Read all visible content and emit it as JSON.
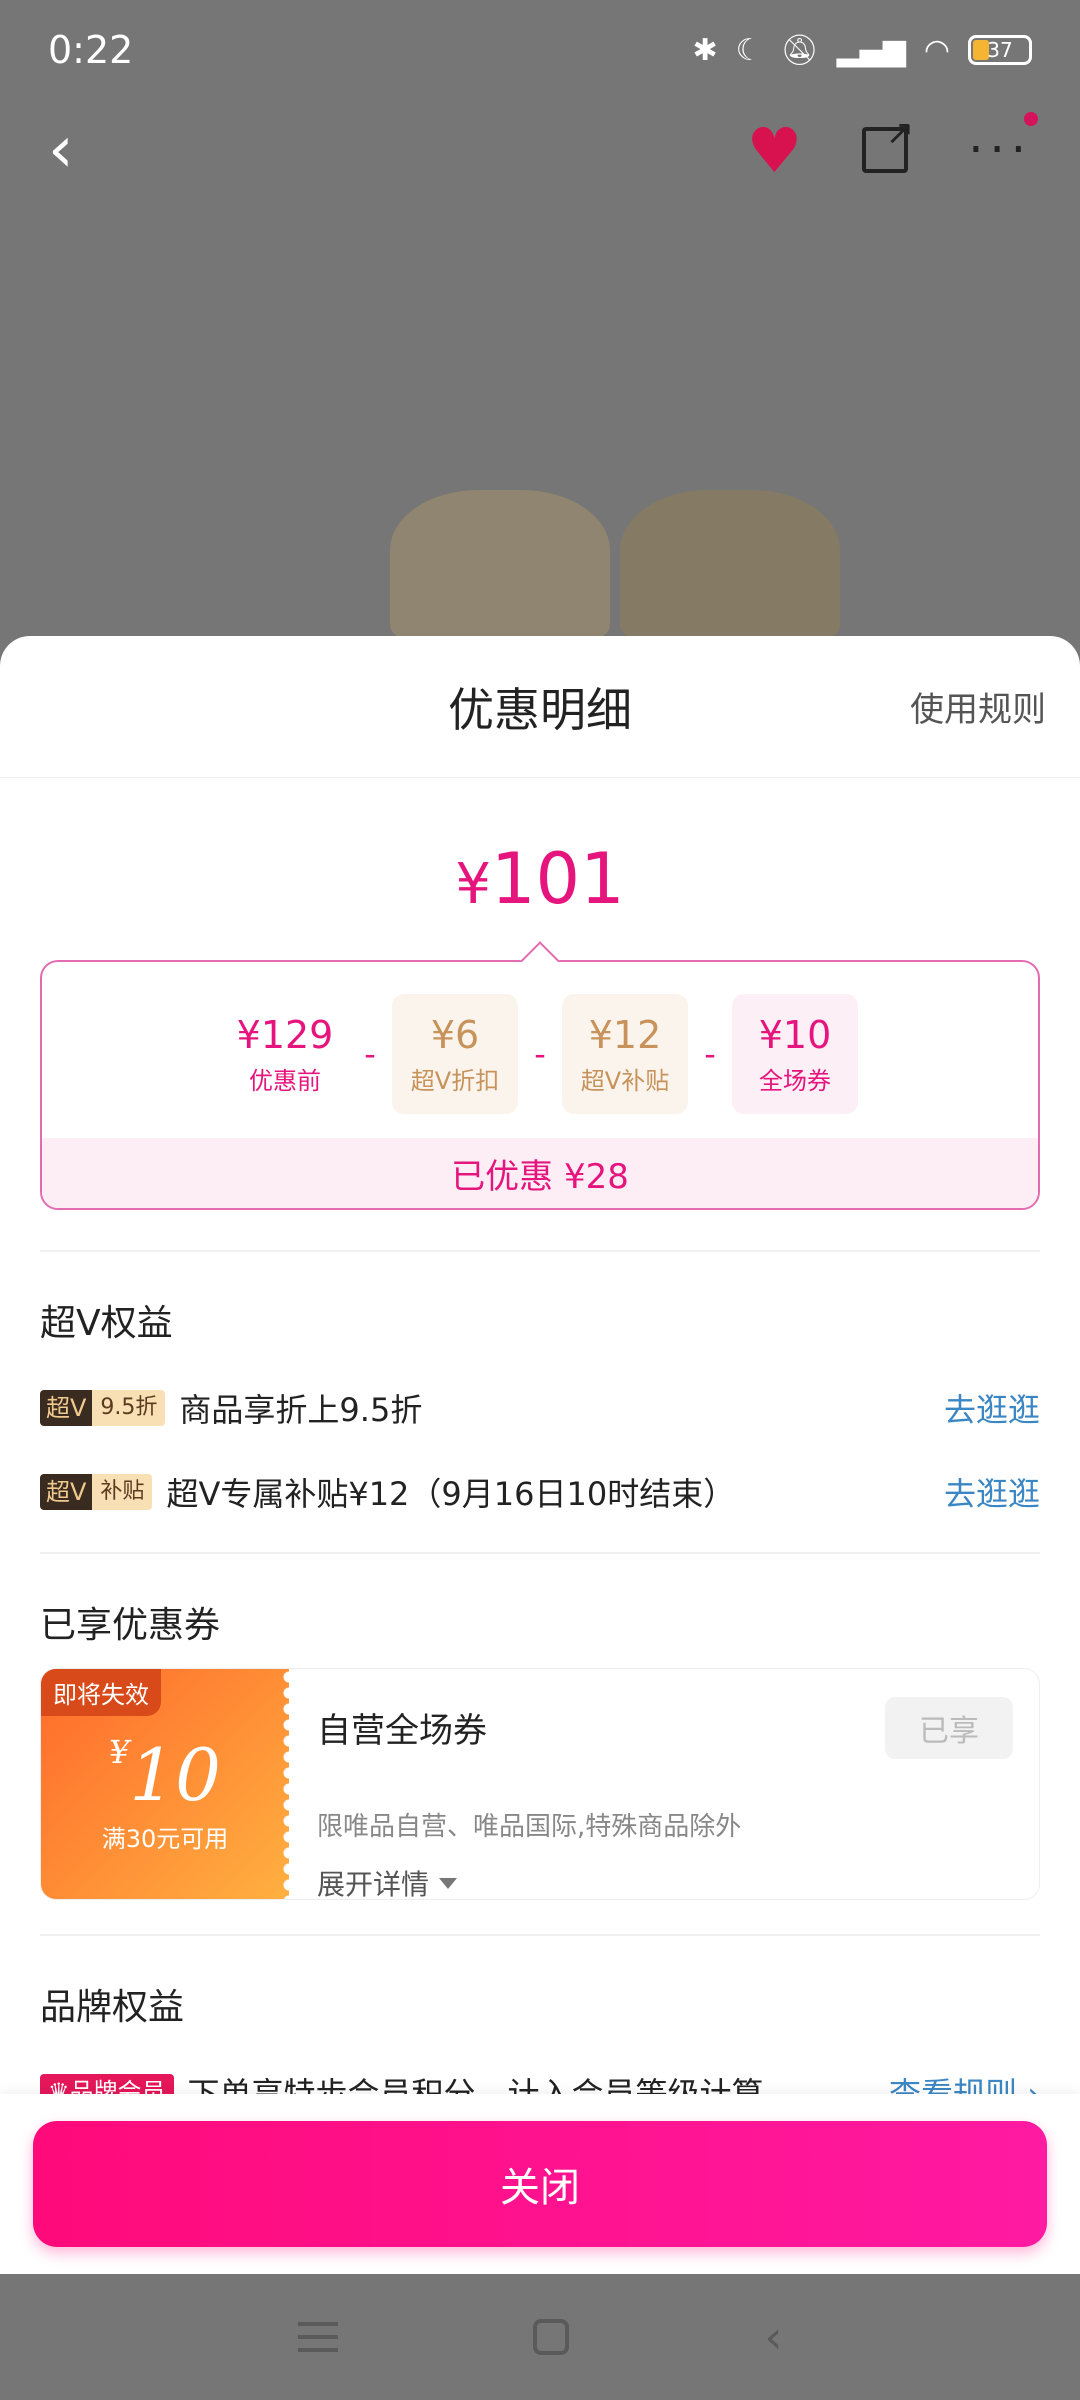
{
  "status_bar": {
    "time": "0:22",
    "battery": "37"
  },
  "discount_sheet": {
    "title": "优惠明细",
    "rules_link": "使用规则",
    "final_price": {
      "currency": "¥",
      "amount": "101"
    },
    "breakdown": {
      "items": [
        {
          "value": "¥129",
          "label": "优惠前"
        },
        {
          "value": "¥6",
          "label": "超V折扣"
        },
        {
          "value": "¥12",
          "label": "超V补贴"
        },
        {
          "value": "¥10",
          "label": "全场券"
        }
      ],
      "minus": "-",
      "saved": "已优惠 ¥28"
    },
    "vip_section": {
      "title": "超V权益",
      "rows": [
        {
          "tag_v": "超V",
          "tag_text": "9.5折",
          "text": "商品享折上9.5折",
          "link": "去逛逛"
        },
        {
          "tag_v": "超V",
          "tag_text": "补贴",
          "text": "超V专属补贴¥12（9月16日10时结束）",
          "link": "去逛逛"
        }
      ]
    },
    "coupon_section": {
      "title": "已享优惠券",
      "coupon": {
        "expiring_badge": "即将失效",
        "currency": "¥",
        "amount": "10",
        "condition": "满30元可用",
        "name": "自营全场券",
        "status": "已享",
        "description": "限唯品自营、唯品国际,特殊商品除外",
        "expand": "展开详情"
      }
    },
    "brand_section": {
      "title": "品牌权益",
      "tag": "♛品牌会员",
      "text": "下单享特步会员积分，计入会员等级计算",
      "link": "查看规则 ›"
    },
    "close_button": "关闭"
  },
  "colors": {
    "accent": "#e5157d",
    "link": "#3b86c4",
    "coupon_orange": "#ff8a2b"
  }
}
